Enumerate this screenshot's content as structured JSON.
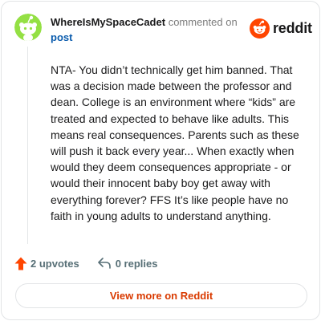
{
  "comment": {
    "username": "WhereIsMySpaceCadet",
    "action_text": "commented on",
    "target_link": "post",
    "body": "NTA- You didn’t technically get him banned. That was a decision made between the professor and dean. College is an environment where “kids” are treated and expected to behave like adults. This means real consequences. Parents such as these will push it back every year... When exactly when would they deem consequences appropriate - or would their innocent baby boy get away with everything forever? FFS It’s like people have no faith in young adults to understand anything."
  },
  "brand": {
    "logo_text": "reddit",
    "accent_color": "#ff4500"
  },
  "actions": {
    "upvotes_label": "2 upvotes",
    "replies_label": "0 replies"
  },
  "footer": {
    "view_more_label": "View more on Reddit"
  },
  "icons": {
    "avatar": "snoo-avatar-icon",
    "logo": "reddit-snoo-icon",
    "upvote": "upvote-arrow-icon",
    "reply": "reply-arrow-icon"
  },
  "colors": {
    "avatar_bg": "#94e044",
    "upvote_color": "#ff4500",
    "link_color": "#0b5cad",
    "view_more_color": "#d93a00"
  }
}
